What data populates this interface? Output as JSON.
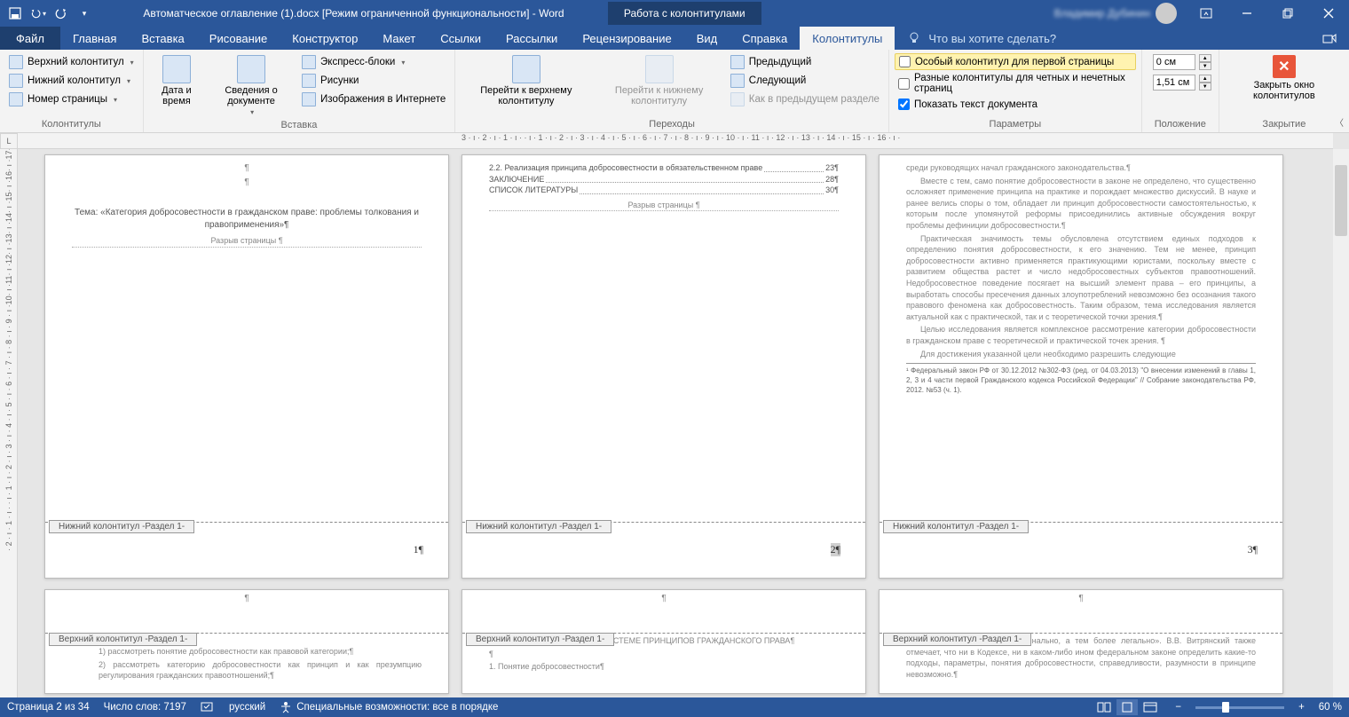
{
  "title": "Автоматческое оглавление (1).docx [Режим ограниченной функциональности]  -  Word",
  "contextual_tab": "Работа с колонтитулами",
  "user_name": "Владимир Дубинин",
  "tabs": {
    "file": "Файл",
    "items": [
      "Главная",
      "Вставка",
      "Рисование",
      "Конструктор",
      "Макет",
      "Ссылки",
      "Рассылки",
      "Рецензирование",
      "Вид",
      "Справка",
      "Колонтитулы"
    ],
    "active": "Колонтитулы",
    "tell_me": "Что вы хотите сделать?"
  },
  "ribbon": {
    "g1": {
      "label": "Колонтитулы",
      "btn1": "Верхний колонтитул",
      "btn2": "Нижний колонтитул",
      "btn3": "Номер страницы"
    },
    "g2": {
      "label": "Вставка",
      "date": "Дата и время",
      "docinfo": "Сведения о документе",
      "express": "Экспресс-блоки",
      "pics": "Рисунки",
      "online": "Изображения в Интернете"
    },
    "g3": {
      "label": "Переходы",
      "goto_top": "Перейти к верхнему колонтитулу",
      "goto_bot": "Перейти к нижнему колонтитулу",
      "prev": "Предыдущий",
      "next": "Следующий",
      "asprev": "Как в предыдущем разделе"
    },
    "g4": {
      "label": "Параметры",
      "first_page": "Особый колонтитул для первой страницы",
      "odd_even": "Разные колонтитулы для четных и нечетных страниц",
      "show_doc": "Показать текст документа"
    },
    "g5": {
      "label": "Положение",
      "top_val": "0 см",
      "bot_val": "1,51 см"
    },
    "g6": {
      "label": "Закрытие",
      "close": "Закрыть окно колонтитулов"
    }
  },
  "ruler_h": "3 · ı · 2 · ı · 1 · ı ·   · ı · 1 · ı · 2 · ı · 3 · ı · 4 · ı · 5 · ı · 6 · ı · 7 · ı · 8 · ı · 9 · ı · 10 · ı · 11 · ı · 12 · ı · 13 · ı · 14 · ı · 15 · ı · 16 · ı ·",
  "ruler_v": "· 2 · ı · 1 · ı ·   · ı · 1 · ı · 2 · ı · 3 · ı · 4 · ı · 5 · ı · 6 · ı · 7 · ı · 8 · ı · 9 · ı ·10· ı ·11· ı ·12· ı ·13· ı ·14· ı ·15· ı ·16· ı ·17· ı ·18· ı",
  "doc": {
    "footer_label": "Нижний колонтитул -Раздел 1-",
    "header_label": "Верхний колонтитул -Раздел 1-",
    "page_break": "Разрыв страницы",
    "page1": {
      "theme": "Тема: «Категория добросовестности в гражданском праве: проблемы толкования и правоприменения»¶",
      "num": "1¶"
    },
    "page2": {
      "toc1_l": "2.2. Реализация принципа добросовестности в обязательственном праве",
      "toc1_r": "23¶",
      "toc2_l": "ЗАКЛЮЧЕНИЕ",
      "toc2_r": "28¶",
      "toc3_l": "СПИСОК ЛИТЕРАТУРЫ",
      "toc3_r": "30¶",
      "num": "2¶"
    },
    "page3": {
      "p1": "среди руководящих начал гражданского законодательства.¶",
      "p2": "Вместе с тем, само понятие добросовестности в законе не определено, что существенно осложняет применение принципа на практике и порождает множество дискуссий. В науке и ранее велись споры о том, обладает ли принцип добросовестности самостоятельностью, к которым после упомянутой реформы присоединились активные обсуждения вокруг проблемы дефиниции добросовестности.¶",
      "p3": "Практическая значимость темы обусловлена отсутствием единых подходов к определению понятия добросовестности, к его значению. Тем не менее, принцип добросовестности активно применяется практикующими юристами, поскольку вместе с развитием общества растет и число недобросовестных субъектов правоотношений. Недобросовестное поведение посягает на высший элемент права – его принципы, а выработать способы пресечения данных злоупотреблений невозможно без осознания такого правового феномена как добросовестность. Таким образом, тема исследования является актуальной как с практической, так и с теоретической точки зрения.¶",
      "p4": "Целью исследования является комплексное рассмотрение категории добросовестности в гражданском праве с теоретической и практической точек зрения. ¶",
      "p5": "Для достижения указанной цели необходимо разрешить следующие",
      "fn": "¹ Федеральный закон РФ от 30.12.2012 №302-ФЗ (ред. от 04.03.2013) \"О внесении изменений в главы 1, 2, 3 и 4 части первой Гражданского кодекса Российской Федерации\" // Собрание законодательства РФ, 2012. №53 (ч. 1).",
      "num": "3¶"
    },
    "page4": {
      "p1": "1) рассмотреть понятие добросовестности как правовой категории;¶",
      "p2": "2) рассмотреть категорию добросовестности как принцип и как презумпцию регулирования гражданских правоотношений;¶"
    },
    "page5": {
      "h1": "ИЯ ДОБРОСОВЕСТНОСТИ В СИСТЕМЕ ПРИНЦИПОВ ГРАЖДАНСКОГО ПРАВА¶",
      "p1": "1. Понятие добросовестности¶"
    },
    "page6": {
      "p1": "разом определена даже доктринально, а тем более легально». В.В. Витрянский также отмечает, что ни в Кодексе, ни в каком-либо ином федеральном законе определить какие-то подходы, параметры, понятия добросовестности, справедливости, разумности в принципе невозможно.¶"
    }
  },
  "status": {
    "page": "Страница 2 из 34",
    "words": "Число слов: 7197",
    "lang": "русский",
    "a11y": "Специальные возможности: все в порядке",
    "zoom": "60 %"
  }
}
